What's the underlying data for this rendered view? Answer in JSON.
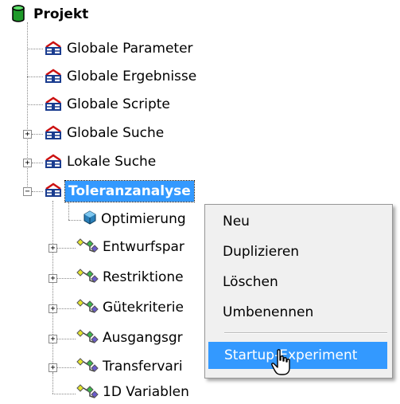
{
  "tree": {
    "root": {
      "label": "Projekt",
      "icon": "database-icon"
    },
    "level1": [
      {
        "label": "Globale Parameter",
        "icon": "folder-group-icon",
        "expander": ""
      },
      {
        "label": "Globale Ergebnisse",
        "icon": "folder-group-icon",
        "expander": ""
      },
      {
        "label": "Globale Scripte",
        "icon": "folder-group-icon",
        "expander": ""
      },
      {
        "label": "Globale Suche",
        "icon": "folder-group-icon",
        "expander": "+"
      },
      {
        "label": "Lokale Suche",
        "icon": "folder-group-icon",
        "expander": "+"
      },
      {
        "label": "Toleranzanalyse",
        "icon": "folder-group-icon",
        "expander": "−",
        "selected": true
      }
    ],
    "level2": [
      {
        "label": "Optimierung",
        "icon": "cube-icon",
        "expander": ""
      },
      {
        "label": "Entwurfspar",
        "icon": "variables-icon",
        "expander": "+"
      },
      {
        "label": "Restriktione",
        "icon": "variables-icon",
        "expander": "+"
      },
      {
        "label": "Gütekriterie",
        "icon": "variables-icon",
        "expander": "+"
      },
      {
        "label": "Ausgangsgr",
        "icon": "variables-icon",
        "expander": "+"
      },
      {
        "label": "Transfervari",
        "icon": "variables-icon",
        "expander": "+"
      },
      {
        "label": "1D Variablen",
        "icon": "variables-icon",
        "expander": ""
      }
    ]
  },
  "context_menu": {
    "items": [
      "Neu",
      "Duplizieren",
      "Löschen",
      "Umbenennen"
    ],
    "highlighted_item": "Startup-Experiment"
  },
  "colors": {
    "selection": "#3399ff",
    "menu_bg": "#f0f0f0",
    "folder_red": "#cc1111",
    "folder_blue": "#1a3c8f"
  }
}
